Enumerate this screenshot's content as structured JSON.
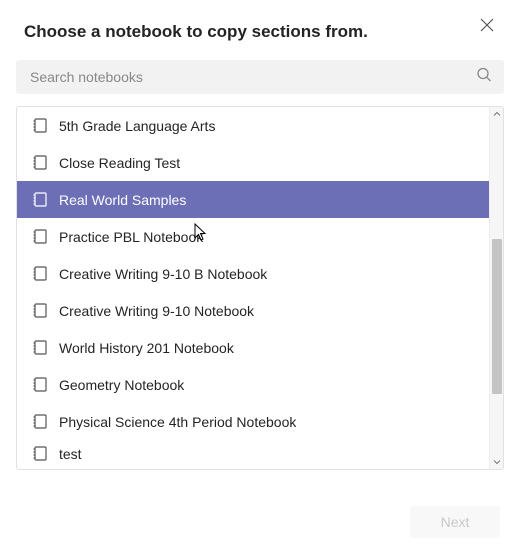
{
  "dialog": {
    "title": "Choose a notebook to copy sections from.",
    "search_placeholder": "Search notebooks",
    "next_label": "Next"
  },
  "notebooks": [
    {
      "label": "5th Grade Language Arts",
      "selected": false
    },
    {
      "label": "Close Reading Test",
      "selected": false
    },
    {
      "label": "Real World Samples",
      "selected": true
    },
    {
      "label": "Practice PBL Notebook",
      "selected": false
    },
    {
      "label": "Creative Writing 9-10 B Notebook",
      "selected": false
    },
    {
      "label": "Creative Writing 9-10 Notebook",
      "selected": false
    },
    {
      "label": "World History 201 Notebook",
      "selected": false
    },
    {
      "label": "Geometry Notebook",
      "selected": false
    },
    {
      "label": "Physical Science 4th Period Notebook",
      "selected": false
    },
    {
      "label": "test",
      "selected": false
    }
  ],
  "icons": {
    "close": "close-icon",
    "search": "search-icon",
    "notebook": "notebook-icon",
    "chevron_up": "chevron-up-icon",
    "chevron_down": "chevron-down-icon"
  }
}
